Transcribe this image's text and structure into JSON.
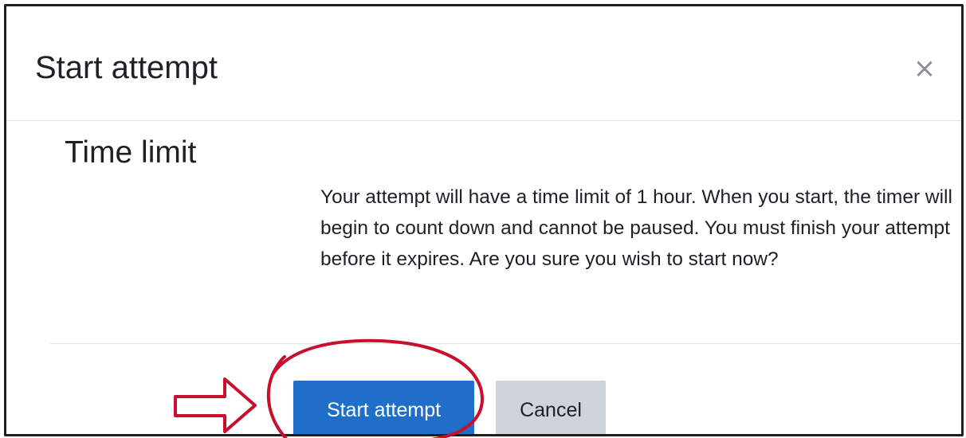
{
  "dialog": {
    "title": "Start attempt",
    "close_symbol": "×",
    "close_icon": "close-icon"
  },
  "section": {
    "title": "Time limit",
    "message": "Your attempt will have a time limit of 1 hour. When you start, the timer will begin to count down and cannot be paused. You must finish your attempt before it expires. Are you sure you wish to start now?"
  },
  "actions": {
    "start_label": "Start attempt",
    "cancel_label": "Cancel"
  },
  "colors": {
    "primary": "#1f6fc9",
    "secondary": "#ced4da",
    "annotation": "#c8102e"
  },
  "annotations": {
    "arrow_icon": "right-arrow-icon",
    "circle_icon": "highlight-circle-icon"
  }
}
